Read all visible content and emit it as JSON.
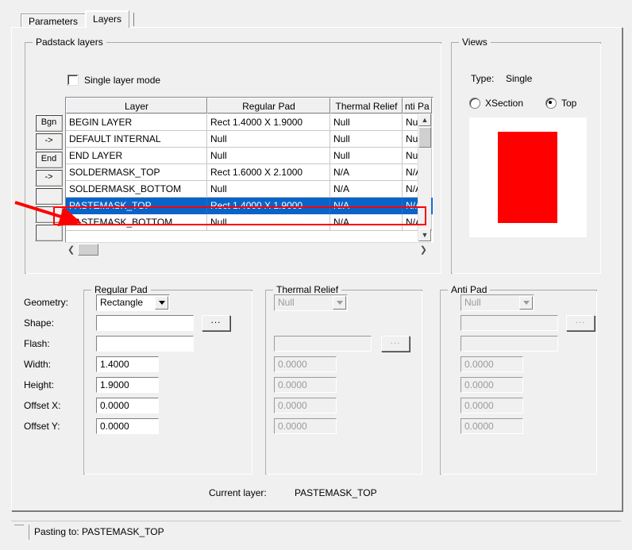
{
  "tabs": [
    {
      "label": "Parameters",
      "active": false
    },
    {
      "label": "Layers",
      "active": true
    }
  ],
  "padstack_layers": {
    "title": "Padstack layers",
    "single_layer_mode": {
      "label": "Single layer mode",
      "checked": false
    },
    "row_buttons": [
      "Bgn",
      "->",
      "End",
      "->",
      "",
      "",
      ""
    ],
    "columns": [
      "Layer",
      "Regular Pad",
      "Thermal Relief",
      "nti Pa"
    ],
    "rows": [
      {
        "layer": "BEGIN LAYER",
        "regular_pad": "Rect 1.4000 X 1.9000",
        "thermal_relief": "Null",
        "anti_pad": "Null",
        "selected": false
      },
      {
        "layer": "DEFAULT INTERNAL",
        "regular_pad": "Null",
        "thermal_relief": "Null",
        "anti_pad": "Null",
        "selected": false
      },
      {
        "layer": "END LAYER",
        "regular_pad": "Null",
        "thermal_relief": "Null",
        "anti_pad": "Null",
        "selected": false
      },
      {
        "layer": "SOLDERMASK_TOP",
        "regular_pad": "Rect 1.6000 X 2.1000",
        "thermal_relief": "N/A",
        "anti_pad": "N/A",
        "selected": false
      },
      {
        "layer": "SOLDERMASK_BOTTOM",
        "regular_pad": "Null",
        "thermal_relief": "N/A",
        "anti_pad": "N/A",
        "selected": false
      },
      {
        "layer": "PASTEMASK_TOP",
        "regular_pad": "Rect 1.4000 X 1.9000",
        "thermal_relief": "N/A",
        "anti_pad": "N/A",
        "selected": true
      },
      {
        "layer": "PASTEMASK_BOTTOM",
        "regular_pad": "Null",
        "thermal_relief": "N/A",
        "anti_pad": "N/A",
        "selected": false
      }
    ],
    "scroll_up_icon": "chevron-up-icon",
    "scroll_down_icon": "chevron-down-icon",
    "scroll_left_icon": "chevron-left-icon",
    "scroll_right_icon": "chevron-right-icon"
  },
  "views": {
    "title": "Views",
    "type_label": "Type:",
    "type_value": "Single",
    "xsection_label": "XSection",
    "top_label": "Top",
    "selected_view": "Top",
    "pad_color": "#ff0000",
    "preview_background": "#ffffff"
  },
  "regular_pad": {
    "title": "Regular Pad",
    "enabled": true,
    "labels": {
      "geometry": "Geometry:",
      "shape": "Shape:",
      "flash": "Flash:",
      "width": "Width:",
      "height": "Height:",
      "offset_x": "Offset X:",
      "offset_y": "Offset Y:"
    },
    "geometry": "Rectangle",
    "shape": "",
    "flash": "",
    "width": "1.4000",
    "height": "1.9000",
    "offset_x": "0.0000",
    "offset_y": "0.0000",
    "browse_label": "..."
  },
  "thermal_relief": {
    "title": "Thermal Relief",
    "enabled": false,
    "geometry": "Null",
    "shape": "",
    "width": "0.0000",
    "height": "0.0000",
    "offset_x": "0.0000",
    "offset_y": "0.0000",
    "browse_label": "..."
  },
  "anti_pad": {
    "title": "Anti Pad",
    "enabled": false,
    "geometry": "Null",
    "shape": "",
    "flash": "",
    "width": "0.0000",
    "height": "0.0000",
    "offset_x": "0.0000",
    "offset_y": "0.0000",
    "browse_label": "..."
  },
  "current_layer": {
    "label": "Current layer:",
    "value": "PASTEMASK_TOP"
  },
  "status": {
    "text": "Pasting to: PASTEMASK_TOP"
  },
  "annotation": {
    "arrow_color": "#ff0000",
    "highlight_color": "#ff0000"
  },
  "colors": {
    "selection_blue": "#0a64c8",
    "face": "#f0f0f0"
  }
}
